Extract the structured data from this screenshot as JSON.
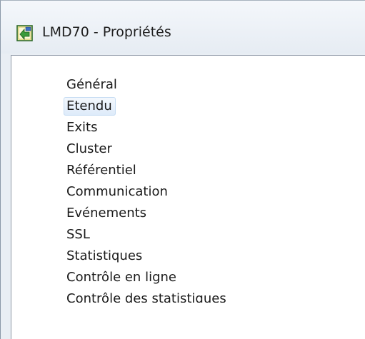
{
  "window": {
    "title": "LMD70 - Propriétés",
    "icon": "properties-app-icon"
  },
  "nav": {
    "items": [
      {
        "label": "Général",
        "selected": false
      },
      {
        "label": "Etendu",
        "selected": true
      },
      {
        "label": "Exits",
        "selected": false
      },
      {
        "label": "Cluster",
        "selected": false
      },
      {
        "label": "Référentiel",
        "selected": false
      },
      {
        "label": "Communication",
        "selected": false
      },
      {
        "label": "Evénements",
        "selected": false
      },
      {
        "label": "SSL",
        "selected": false
      },
      {
        "label": "Statistiques",
        "selected": false
      },
      {
        "label": "Contrôle en ligne",
        "selected": false
      },
      {
        "label": "Contrôle des statistiques",
        "selected": false
      }
    ]
  },
  "colors": {
    "selection_border": "#c6dcf3",
    "selection_fill": "#deebfa",
    "titlebar": "#e6ecf3"
  }
}
